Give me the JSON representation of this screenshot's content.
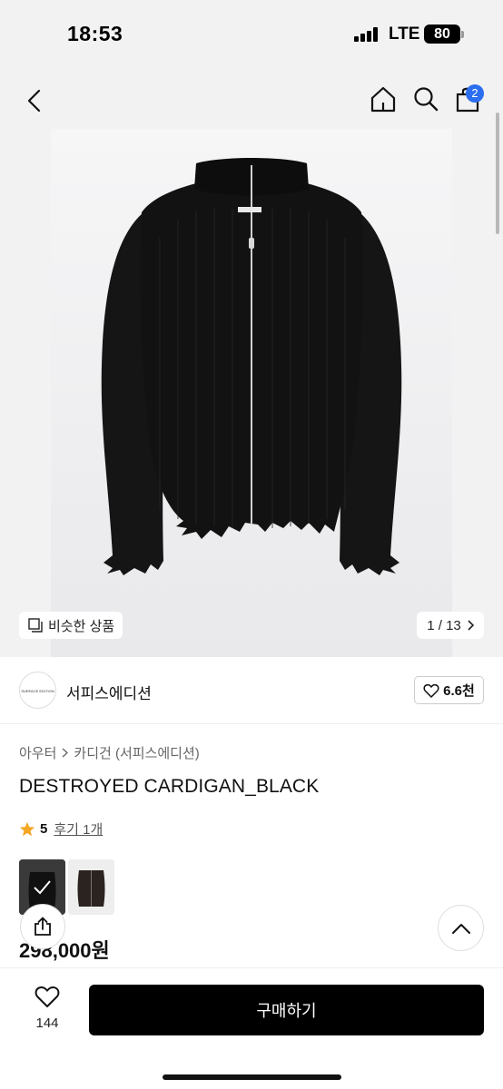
{
  "status": {
    "time": "18:53",
    "network": "LTE",
    "battery": "80"
  },
  "header": {
    "cart_count": "2"
  },
  "gallery": {
    "similar_label": "비슷한 상품",
    "counter": "1 / 13"
  },
  "brand": {
    "name": "서피스에디션",
    "logo_text": "SURFACE EDITION",
    "likes": "6.6천"
  },
  "breadcrumb": {
    "first": "아우터",
    "second": "카디건 (서피스에디션)"
  },
  "product": {
    "title": "DESTROYED CARDIGAN_BLACK",
    "rating": "5",
    "reviews": "후기 1개",
    "price": "298,000원"
  },
  "bottom": {
    "wish_count": "144",
    "buy_label": "구매하기"
  },
  "colors": {
    "accent": "#2b6ef0",
    "star": "#f5a623",
    "buy_button": "#000000"
  }
}
